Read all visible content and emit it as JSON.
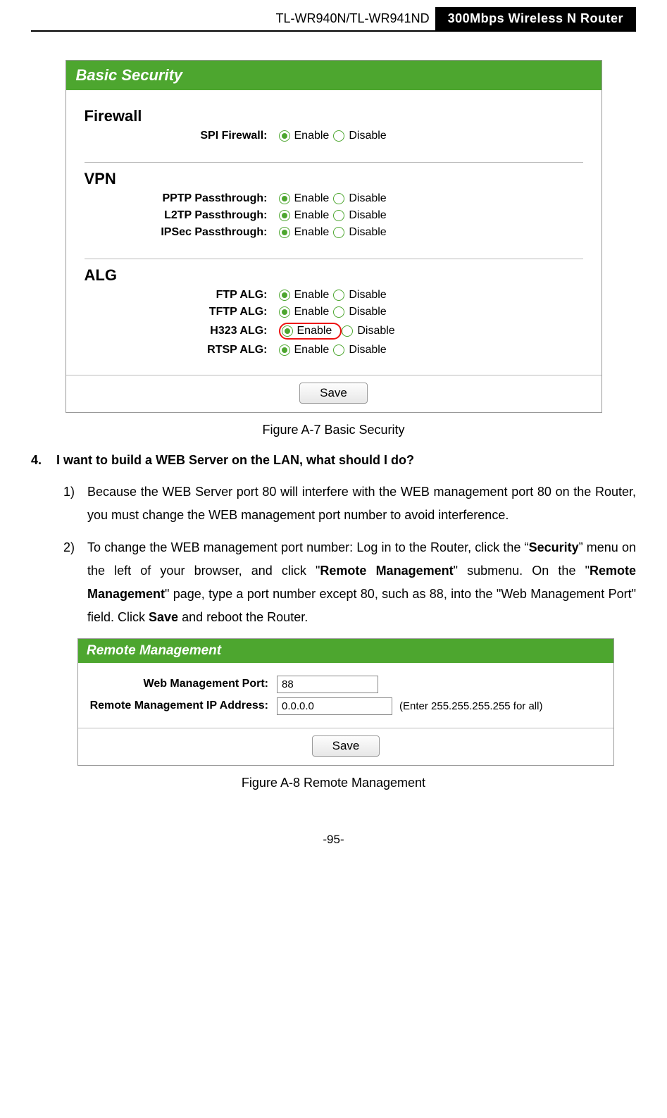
{
  "header": {
    "model": "TL-WR940N/TL-WR941ND",
    "product": "300Mbps Wireless N Router"
  },
  "basic_security": {
    "title": "Basic Security",
    "firewall": {
      "heading": "Firewall",
      "spi_label": "SPI Firewall:"
    },
    "vpn": {
      "heading": "VPN",
      "pptp": "PPTP Passthrough:",
      "l2tp": "L2TP Passthrough:",
      "ipsec": "IPSec Passthrough:"
    },
    "alg": {
      "heading": "ALG",
      "ftp": "FTP ALG:",
      "tftp": "TFTP ALG:",
      "h323": "H323 ALG:",
      "rtsp": "RTSP ALG:"
    },
    "options": {
      "enable": "Enable",
      "disable": "Disable"
    },
    "save": "Save"
  },
  "captions": {
    "figA7": "Figure A-7 Basic Security",
    "figA8": "Figure A-8 Remote Management"
  },
  "question": {
    "num": "4.",
    "text": "I want to build a WEB Server on the LAN, what should I do?"
  },
  "steps": {
    "s1n": "1)",
    "s1": "Because the WEB Server port 80 will interfere with the WEB management port 80 on the Router, you must change the WEB management port number to avoid interference.",
    "s2n": "2)",
    "s2a": "To change the WEB management port number: Log in to the Router, click the “",
    "s2b": "Security",
    "s2c": "” menu on the left of your browser, and click \"",
    "s2d": "Remote Management",
    "s2e": "\" submenu. On the \"",
    "s2f": "Remote Management",
    "s2g": "\" page, type a port number except 80, such as 88, into the \"Web Management Port\" field. Click ",
    "s2h": "Save",
    "s2i": " and reboot the Router."
  },
  "remote": {
    "title": "Remote Management",
    "port_label": "Web Management Port:",
    "port_value": "88",
    "ip_label": "Remote Management IP Address:",
    "ip_value": "0.0.0.0",
    "ip_hint": "(Enter 255.255.255.255 for all)",
    "save": "Save"
  },
  "page_num": "-95-"
}
